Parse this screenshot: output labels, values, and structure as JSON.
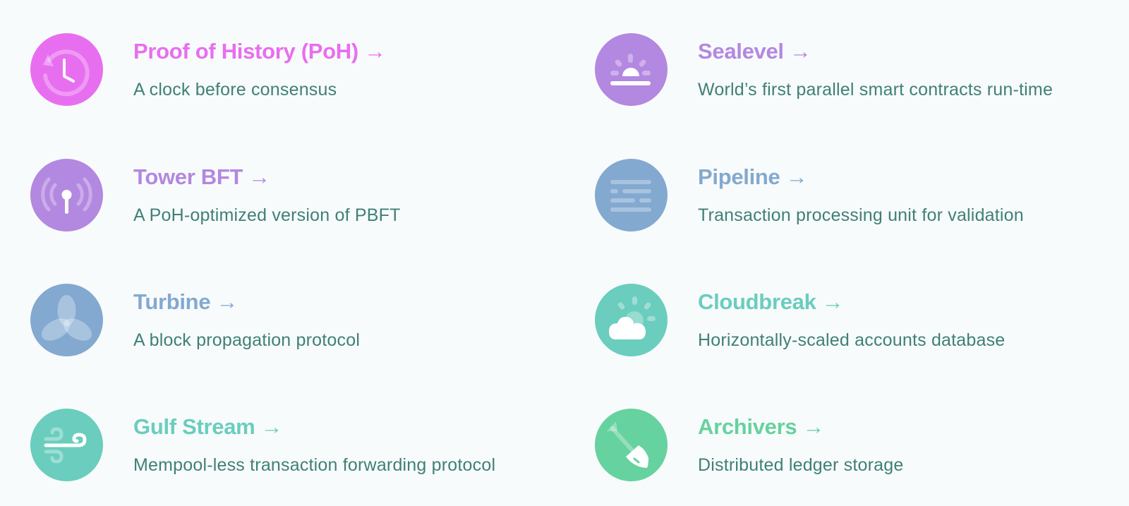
{
  "arrow_glyph": "→",
  "features": [
    {
      "id": "poh",
      "title": "Proof of History (PoH)",
      "description": "A clock before consensus",
      "icon": "clock-history-icon",
      "color": "#e86ef0"
    },
    {
      "id": "sealevel",
      "title": "Sealevel",
      "description": "World’s first parallel smart contracts run-time",
      "icon": "sunrise-icon",
      "color": "#b388e0"
    },
    {
      "id": "tower-bft",
      "title": "Tower BFT",
      "description": "A PoH-optimized version of PBFT",
      "icon": "broadcast-tower-icon",
      "color": "#b388e0"
    },
    {
      "id": "pipeline",
      "title": "Pipeline",
      "description": "Transaction processing unit for validation",
      "icon": "pipeline-lines-icon",
      "color": "#83a9d0"
    },
    {
      "id": "turbine",
      "title": "Turbine",
      "description": "A block propagation protocol",
      "icon": "turbine-petals-icon",
      "color": "#83a9d0"
    },
    {
      "id": "cloudbreak",
      "title": "Cloudbreak",
      "description": "Horizontally-scaled accounts database",
      "icon": "cloud-sun-icon",
      "color": "#6acdbe"
    },
    {
      "id": "gulf-stream",
      "title": "Gulf Stream",
      "description": "Mempool-less transaction forwarding protocol",
      "icon": "wind-icon",
      "color": "#6acdbe"
    },
    {
      "id": "archivers",
      "title": "Archivers",
      "description": "Distributed ledger storage",
      "icon": "shovel-icon",
      "color": "#66d29f"
    }
  ]
}
